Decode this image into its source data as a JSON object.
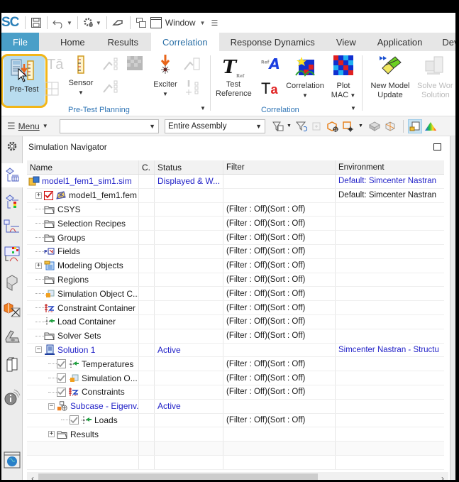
{
  "quick_access": {
    "app_logo": "SC",
    "icons": [
      "save-icon",
      "undo-icon",
      "settings-gear-icon",
      "magnet-pin-icon",
      "window-arrange-icon",
      "window-icon"
    ],
    "window_label": "Window"
  },
  "tabs": [
    {
      "label": "File",
      "kind": "file"
    },
    {
      "label": "Home"
    },
    {
      "label": "Results"
    },
    {
      "label": "Correlation",
      "active": true
    },
    {
      "label": "Response Dynamics"
    },
    {
      "label": "View"
    },
    {
      "label": "Application"
    },
    {
      "label": "Deve"
    }
  ],
  "ribbon": {
    "pretest_planning": {
      "group_label": "Pre-Test Planning",
      "pretest_label": "Pre-Test",
      "sensor_label": "Sensor",
      "exciter_label": "Exciter"
    },
    "correlation": {
      "group_label": "Correlation",
      "test_reference_line1": "Test",
      "test_reference_line2": "Reference",
      "correlation_label": "Correlation",
      "plot_mac_line1": "Plot",
      "plot_mac_line2": "MAC"
    },
    "model_update": {
      "new_model_line1": "New Model",
      "new_model_line2": "Update",
      "solve_line1": "Solve Wor",
      "solve_line2": "Solution"
    }
  },
  "selection_bar": {
    "menu_label": "Menu",
    "filter_combo_value": "",
    "scope_combo_value": "Entire Assembly"
  },
  "navigator": {
    "title": "Simulation Navigator",
    "columns": [
      "Name",
      "C.",
      "Status",
      "Filter",
      "Environment"
    ],
    "rows": [
      {
        "name": "model1_fem1_sim1.sim",
        "icon": "sim-file-icon",
        "level": 0,
        "name_blue": true,
        "status": "Displayed & W...",
        "filter": "",
        "env": "Default: Simcenter Nastran",
        "env_blue": true
      },
      {
        "name": "model1_fem1.fem",
        "icon": "fem-mesh-icon",
        "level": 1,
        "expander": "+",
        "checkbox": "red-checked",
        "status": "",
        "filter": "",
        "env": "Default: Simcenter Nastran"
      },
      {
        "name": "CSYS",
        "icon": "folder-icon",
        "level": 1,
        "status": "",
        "filter": "(Filter : Off)(Sort : Off)",
        "env": ""
      },
      {
        "name": "Selection Recipes",
        "icon": "folder-icon",
        "level": 1,
        "status": "",
        "filter": "(Filter : Off)(Sort : Off)",
        "env": ""
      },
      {
        "name": "Groups",
        "icon": "folder-icon",
        "level": 1,
        "status": "",
        "filter": "(Filter : Off)(Sort : Off)",
        "env": ""
      },
      {
        "name": "Fields",
        "icon": "fields-icon",
        "level": 1,
        "status": "",
        "filter": "(Filter : Off)(Sort : Off)",
        "env": ""
      },
      {
        "name": "Modeling Objects",
        "icon": "modeling-objects-icon",
        "level": 1,
        "expander": "+",
        "status": "",
        "filter": "(Filter : Off)(Sort : Off)",
        "env": ""
      },
      {
        "name": "Regions",
        "icon": "folder-icon",
        "level": 1,
        "status": "",
        "filter": "(Filter : Off)(Sort : Off)",
        "env": ""
      },
      {
        "name": "Simulation Object C...",
        "icon": "simulation-object-icon",
        "level": 1,
        "status": "",
        "filter": "(Filter : Off)(Sort : Off)",
        "env": ""
      },
      {
        "name": "Constraint Container",
        "icon": "constraint-icon",
        "level": 1,
        "status": "",
        "filter": "(Filter : Off)(Sort : Off)",
        "env": ""
      },
      {
        "name": "Load Container",
        "icon": "load-icon",
        "level": 1,
        "status": "",
        "filter": "(Filter : Off)(Sort : Off)",
        "env": ""
      },
      {
        "name": "Solver Sets",
        "icon": "folder-icon",
        "level": 1,
        "status": "",
        "filter": "(Filter : Off)(Sort : Off)",
        "env": ""
      },
      {
        "name": "Solution 1",
        "icon": "solution-icon",
        "level": 1,
        "expander": "−",
        "name_blue": true,
        "status": "Active",
        "filter": "",
        "env": "Simcenter Nastran - Structu",
        "env_blue": true
      },
      {
        "name": "Temperatures",
        "icon": "load-icon",
        "level": 2,
        "checkbox": "gray-checked",
        "status": "",
        "filter": "(Filter : Off)(Sort : Off)",
        "env": ""
      },
      {
        "name": "Simulation O...",
        "icon": "simulation-object-icon",
        "level": 2,
        "checkbox": "gray-checked",
        "status": "",
        "filter": "(Filter : Off)(Sort : Off)",
        "env": ""
      },
      {
        "name": "Constraints",
        "icon": "constraint-icon",
        "level": 2,
        "checkbox": "gray-checked",
        "status": "",
        "filter": "(Filter : Off)(Sort : Off)",
        "env": ""
      },
      {
        "name": "Subcase - Eigenv...",
        "icon": "subcase-icon",
        "level": 2,
        "expander": "−",
        "name_blue": true,
        "status": "Active",
        "filter": "",
        "env": ""
      },
      {
        "name": "Loads",
        "icon": "load-icon",
        "level": 3,
        "checkbox": "gray-checked",
        "status": "",
        "filter": "(Filter : Off)(Sort : Off)",
        "env": ""
      },
      {
        "name": "Results",
        "icon": "folder-icon",
        "level": 2,
        "expander": "+",
        "status": "",
        "filter": "",
        "env": ""
      },
      {
        "name": "",
        "level": 0,
        "status": "",
        "filter": "",
        "env": ""
      },
      {
        "name": "",
        "level": 0,
        "status": "",
        "filter": "",
        "env": ""
      }
    ]
  },
  "resource_bar": {
    "items": [
      "navigator-settings-icon",
      "simulation-navigator-icon",
      "post-processing-navigator-icon",
      "xy-function-navigator-icon",
      "correlation-navigator-icon",
      "assembly-navigator-icon",
      "part-navigator-icon",
      "reuse-library-icon",
      "history-icon",
      "system-info-icon",
      "web-browser-icon"
    ]
  },
  "colors": {
    "accent_blue": "#2e74b5",
    "file_tab": "#4a9fc8",
    "highlight_ring": "#f2b619",
    "link_blue": "#2323c8"
  }
}
